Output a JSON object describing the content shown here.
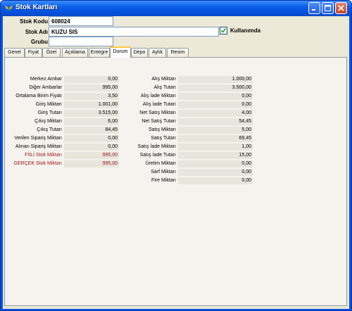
{
  "window": {
    "title": "Stok Kartları"
  },
  "fields": {
    "stok_kodu_label": "Stok Kodu",
    "stok_kodu_value": "608024",
    "stok_adi_label": "Stok Adı",
    "stok_adi_value": "KUZU SIS",
    "grubu_label": "Grubu",
    "grubu_value": "",
    "kullanimda_label": "Kullanımda",
    "kullanimda_checked": true
  },
  "tabs": [
    "Genel",
    "Fiyat",
    "Özel",
    "Açıklama",
    "Entegre",
    "Durum",
    "Depo",
    "Aylık",
    "Resim"
  ],
  "active_tab": "Durum",
  "left_rows": [
    {
      "label": "Merkez Ambar",
      "value": "0,00"
    },
    {
      "label": "Diğer Ambarlar",
      "value": "995,00"
    },
    {
      "label": "Ortalama Birim Fiyatı",
      "value": "3,50"
    },
    {
      "label": "Giriş Miktarı",
      "value": "1.001,00"
    },
    {
      "label": "Giriş Tutarı",
      "value": "3.515,00"
    },
    {
      "label": "Çıkış Miktarı",
      "value": "6,00"
    },
    {
      "label": "Çıkış Tutarı",
      "value": "84,45"
    },
    {
      "label": "Verilen Sipariş Miktarı",
      "value": "0,00"
    },
    {
      "label": "Alınan Sipariş Miktarı",
      "value": "0,00"
    },
    {
      "label": "FİİLİ Stok Miktarı",
      "value": "995,00",
      "highlight": true
    },
    {
      "label": "GERÇEK Stok Miktarı",
      "value": "995,00",
      "highlight": true
    }
  ],
  "right_rows": [
    {
      "label": "Alış Miktarı",
      "value": "1.000,00"
    },
    {
      "label": "Alış Tutarı",
      "value": "3.500,00"
    },
    {
      "label": "Alış İade Miktarı",
      "value": "0,00"
    },
    {
      "label": "Alış İade Tutarı",
      "value": "0,00"
    },
    {
      "label": "Net Satış Miktarı",
      "value": "4,00"
    },
    {
      "label": "Net Satış Tutarı",
      "value": "54,45"
    },
    {
      "label": "Satış Miktarı",
      "value": "5,00"
    },
    {
      "label": "Satış Tutarı",
      "value": "69,45"
    },
    {
      "label": "Satış İade Miktarı",
      "value": "1,00"
    },
    {
      "label": "Satış İade Tutarı",
      "value": "15,00"
    },
    {
      "label": "Üretim Miktarı",
      "value": "0,00"
    },
    {
      "label": "Sarf Miktarı",
      "value": "0,00"
    },
    {
      "label": "Fire Miktarı",
      "value": "0,00"
    }
  ],
  "colors": {
    "title_bar": "#0a5ee8",
    "highlight_text": "#a01818",
    "active_tab_accent": "#ffc83c"
  },
  "icons": {
    "app": "butterfly-icon",
    "minimize": "minimize-icon",
    "maximize": "maximize-icon",
    "close": "close-icon",
    "check": "check-icon"
  }
}
